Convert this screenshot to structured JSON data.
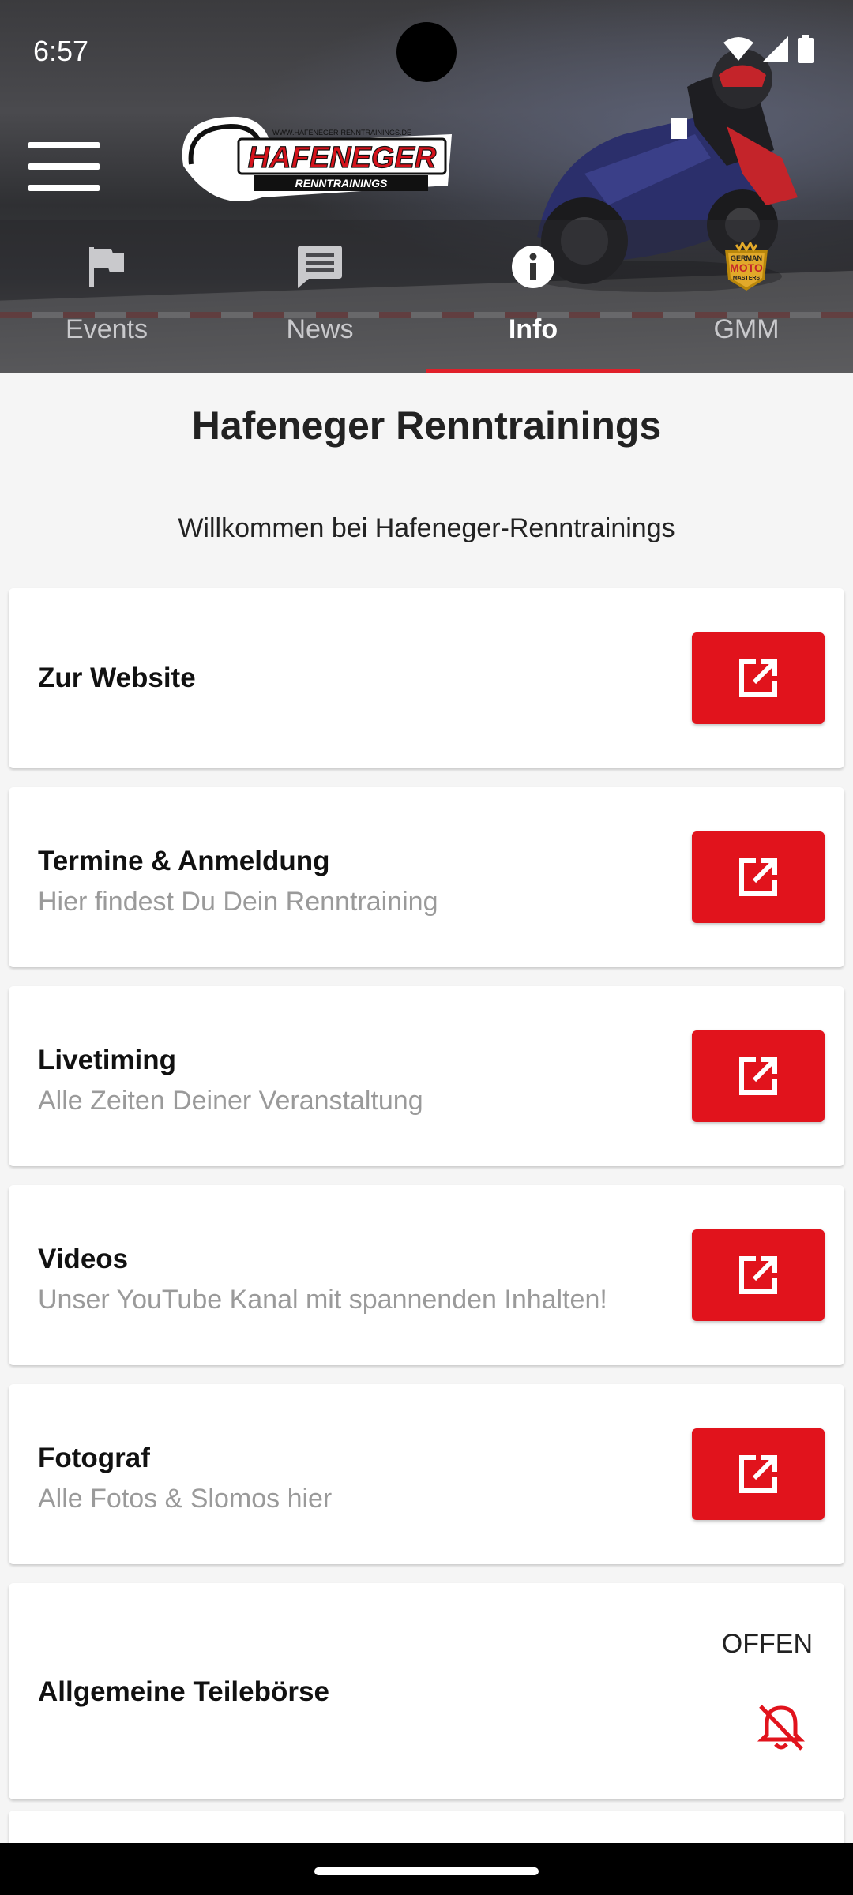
{
  "status_bar": {
    "time": "6:57"
  },
  "header": {
    "logo_text": "HAFENEGER",
    "logo_sub": "RENNTRAININGS",
    "logo_url": "WWW.HAFENEGER-RENNTRAININGS.DE"
  },
  "tabs": [
    {
      "label": "Events",
      "icon": "flag-icon"
    },
    {
      "label": "News",
      "icon": "message-icon"
    },
    {
      "label": "Info",
      "icon": "info-icon",
      "active": true
    },
    {
      "label": "GMM",
      "icon": "gmm-logo-icon"
    }
  ],
  "gmm_logo_text": [
    "GERMAN",
    "MOTO",
    "MASTERS"
  ],
  "page": {
    "title": "Hafeneger Renntrainings",
    "welcome": "Willkommen bei Hafeneger-Renntrainings"
  },
  "cards": [
    {
      "title": "Zur Website",
      "subtitle": ""
    },
    {
      "title": "Termine & Anmeldung",
      "subtitle": "Hier findest Du Dein Renntraining"
    },
    {
      "title": "Livetiming",
      "subtitle": "Alle Zeiten Deiner Veranstaltung"
    },
    {
      "title": "Videos",
      "subtitle": "Unser YouTube Kanal mit spannenden Inhalten!"
    },
    {
      "title": "Fotograf",
      "subtitle": "Alle Fotos & Slomos hier"
    }
  ],
  "marketplace": {
    "title": "Allgemeine Teilebörse",
    "status": "OFFEN",
    "icon": "bell-off-icon"
  },
  "colors": {
    "accent": "#e1131c",
    "tab_indicator": "#e0202a"
  }
}
